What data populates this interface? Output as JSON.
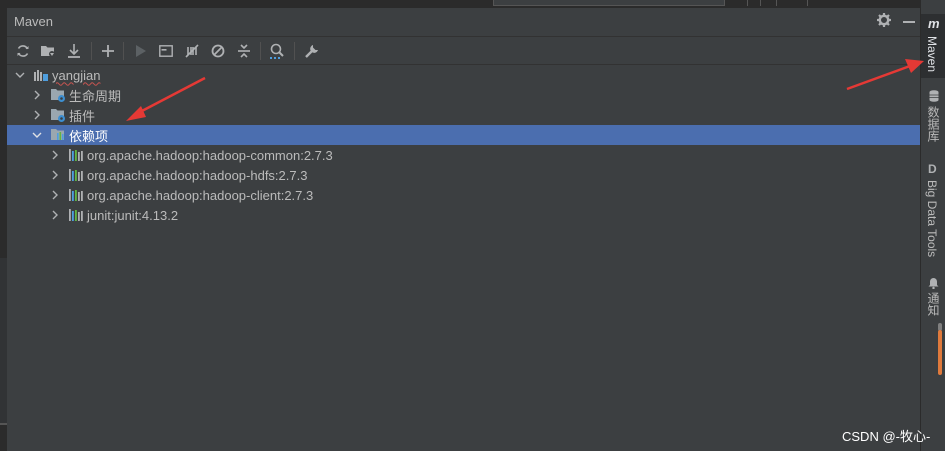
{
  "panel": {
    "title": "Maven"
  },
  "header_icons": [
    "gear-icon",
    "minimize-icon"
  ],
  "toolbar": {
    "buttons": [
      {
        "name": "reload-all-icon",
        "enabled": true
      },
      {
        "name": "generate-sources-icon",
        "enabled": true
      },
      {
        "name": "download-sources-icon",
        "enabled": true
      },
      {
        "name": "add-maven-project-icon",
        "enabled": true
      },
      {
        "name": "run-maven-build-icon",
        "enabled": false
      },
      {
        "name": "execute-maven-goal-icon",
        "enabled": true
      },
      {
        "name": "toggle-offline-mode-icon",
        "enabled": true
      },
      {
        "name": "skip-tests-icon",
        "enabled": true
      },
      {
        "name": "collapse-all-icon",
        "enabled": true
      },
      {
        "name": "analyze-dependencies-icon",
        "enabled": true
      },
      {
        "name": "maven-settings-icon",
        "enabled": true
      }
    ]
  },
  "tree": {
    "project": "yangjian",
    "lifecycle": "生命周期",
    "plugins": "插件",
    "dependencies": "依赖项",
    "deps": [
      "org.apache.hadoop:hadoop-common:2.7.3",
      "org.apache.hadoop:hadoop-hdfs:2.7.3",
      "org.apache.hadoop:hadoop-client:2.7.3",
      "junit:junit:4.13.2"
    ]
  },
  "right_tabs": {
    "maven": "Maven",
    "database": "数据库",
    "bigdata": "Big Data Tools",
    "notifications": "通知"
  },
  "watermark": "CSDN @-牧心-",
  "colors": {
    "selection": "#4b6eaf",
    "background": "#3c3f41",
    "annotation_arrow": "#e53935"
  }
}
